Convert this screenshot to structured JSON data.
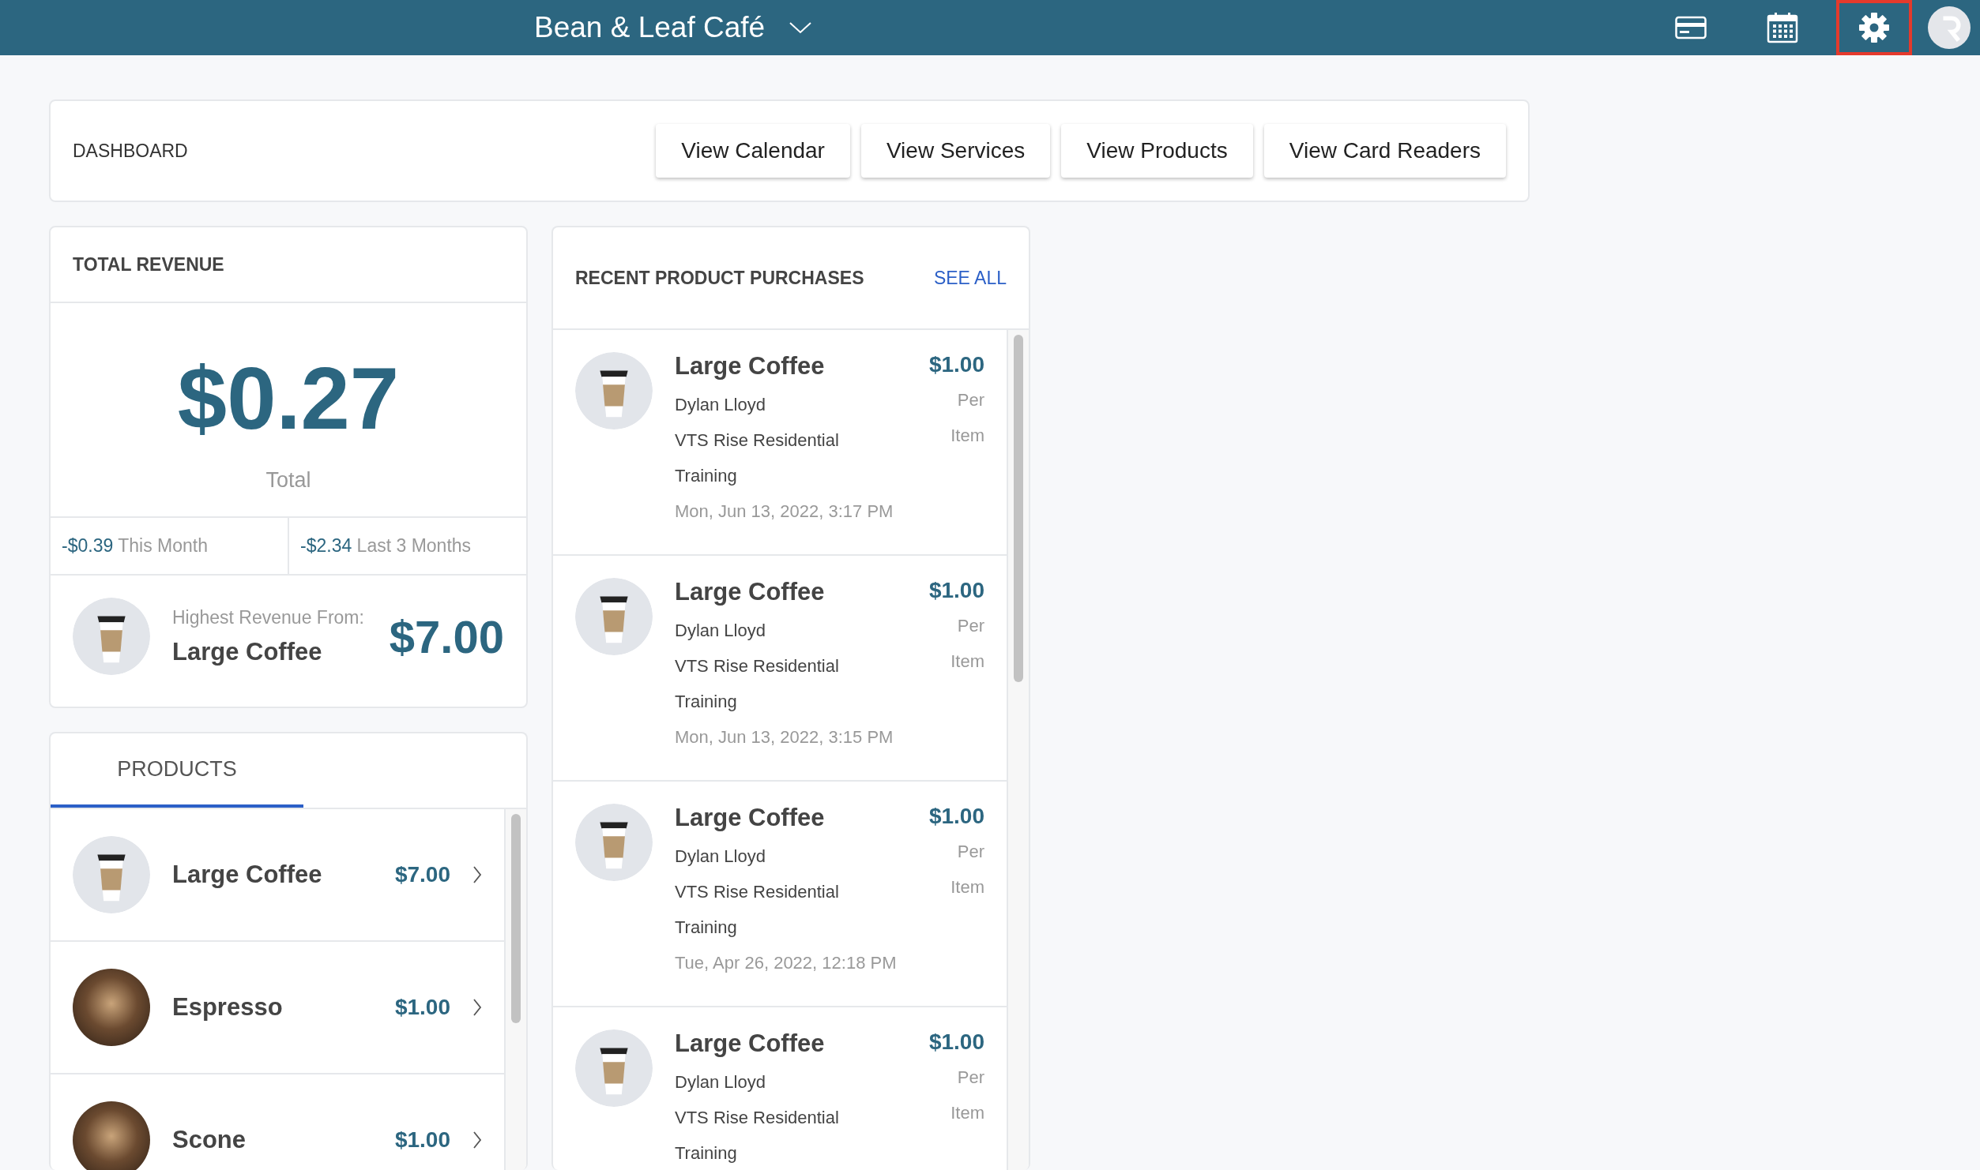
{
  "top_bar": {
    "title": "Bean & Leaf Café",
    "icons": [
      {
        "kind": "card",
        "highlighted": false
      },
      {
        "kind": "calendar",
        "highlighted": false
      },
      {
        "kind": "settings",
        "highlighted": true
      }
    ]
  },
  "dashboard": {
    "label": "DASHBOARD",
    "buttons": [
      "View Calendar",
      "View Services",
      "View Products",
      "View Card Readers"
    ]
  },
  "total_revenue": {
    "title": "TOTAL REVENUE",
    "amount": "$0.27",
    "amount_label": "Total",
    "stats": [
      {
        "value": "-$0.39",
        "label": "This Month"
      },
      {
        "value": "-$2.34",
        "label": "Last 3 Months"
      }
    ],
    "highest": {
      "label": "Highest Revenue From:",
      "product": "Large Coffee",
      "amount": "$7.00",
      "kind": "cup"
    }
  },
  "products": {
    "tabs": [
      {
        "label": "PRODUCTS",
        "selected": true
      }
    ],
    "items": [
      {
        "name": "Large Coffee",
        "price": "$7.00",
        "kind": "cup"
      },
      {
        "name": "Espresso",
        "price": "$1.00",
        "kind": "photo"
      },
      {
        "name": "Scone",
        "price": "$1.00",
        "kind": "photo"
      }
    ]
  },
  "recent_purchases": {
    "title": "RECENT PRODUCT PURCHASES",
    "see_all": "SEE ALL",
    "items": [
      {
        "product": "Large Coffee",
        "customer": "Dylan Lloyd",
        "location": "VTS Rise Residential Training",
        "date": "Mon, Jun 13, 2022, 3:17 PM",
        "price": "$1.00",
        "unit": "Per Item",
        "kind": "cup"
      },
      {
        "product": "Large Coffee",
        "customer": "Dylan Lloyd",
        "location": "VTS Rise Residential Training",
        "date": "Mon, Jun 13, 2022, 3:15 PM",
        "price": "$1.00",
        "unit": "Per Item",
        "kind": "cup"
      },
      {
        "product": "Large Coffee",
        "customer": "Dylan Lloyd",
        "location": "VTS Rise Residential Training",
        "date": "Tue, Apr 26, 2022, 12:18 PM",
        "price": "$1.00",
        "unit": "Per Item",
        "kind": "cup"
      },
      {
        "product": "Large Coffee",
        "customer": "Dylan Lloyd",
        "location": "VTS Rise Residential Training",
        "price": "$1.00",
        "unit": "Per Item",
        "kind": "cup"
      }
    ]
  }
}
